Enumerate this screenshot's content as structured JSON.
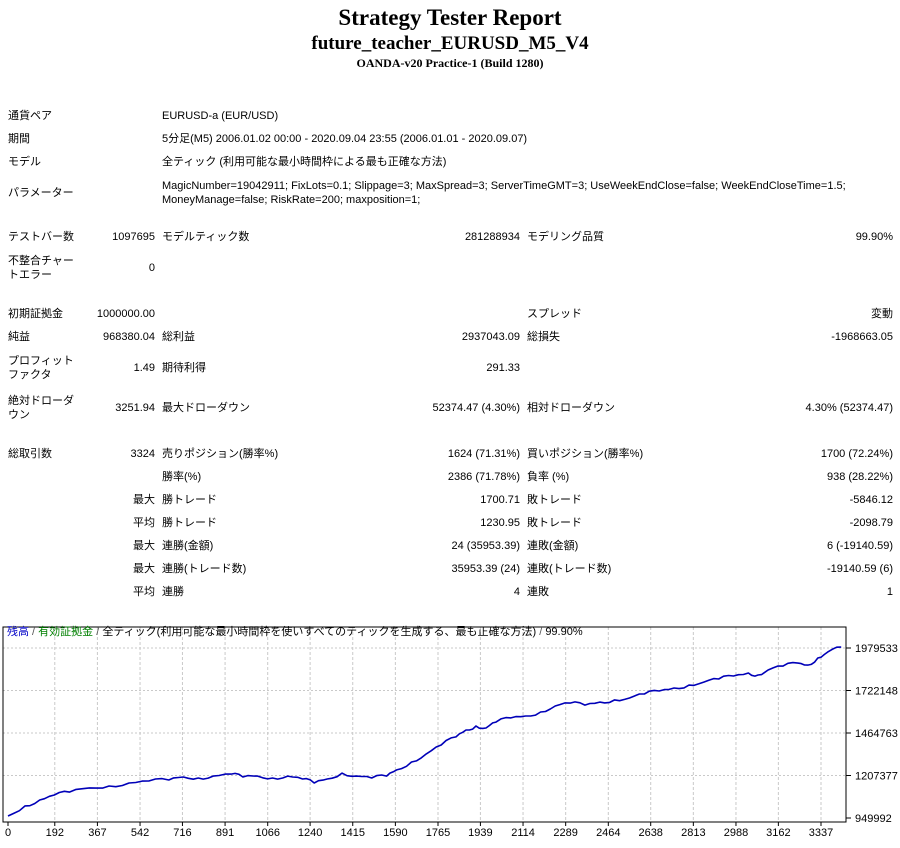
{
  "header": {
    "title": "Strategy Tester Report",
    "subtitle": "future_teacher_EURUSD_M5_V4",
    "server": "OANDA-v20 Practice-1 (Build 1280)"
  },
  "report_rows": [
    {
      "label": "通貨ペア",
      "span_lines": [
        "EURUSD-a (EUR/USD)"
      ]
    },
    {
      "label": "期間",
      "span_lines": [
        "5分足(M5) 2006.01.02 00:00 - 2020.09.04 23:55 (2006.01.01 - 2020.09.07)"
      ]
    },
    {
      "label": "モデル",
      "span_lines": [
        "全ティック (利用可能な最小時間枠による最も正確な方法)"
      ]
    },
    {
      "label": "パラメーター",
      "tall": true,
      "span_lines": [
        "MagicNumber=19042911; FixLots=0.1; Slippage=3; MaxSpread=3; ServerTimeGMT=3; UseWeekEndClose=false; WeekEndCloseTime=1.5;",
        "MoneyManage=false; RiskRate=200; maxposition=1;"
      ]
    },
    {
      "spacer": 1
    },
    {
      "label": "テストバー数",
      "v1": "1097695",
      "l2": "モデルティック数",
      "v2": "281288934",
      "l3": "モデリング品質",
      "v3": "99.90%"
    },
    {
      "label": "不整合チャートエラー",
      "tall": true,
      "v1": "0",
      "l2": "",
      "v2": "",
      "l3": "",
      "v3": ""
    },
    {
      "spacer": 2
    },
    {
      "label": "初期証拠金",
      "v1": "1000000.00",
      "l2": "",
      "v2": "",
      "l3": "スプレッド",
      "v3": "変動"
    },
    {
      "label": "純益",
      "v1": "968380.04",
      "l2": "総利益",
      "v2": "2937043.09",
      "l3": "総損失",
      "v3": "-1968663.05"
    },
    {
      "label": "プロフィットファクタ",
      "tall": true,
      "v1": "1.49",
      "l2": "期待利得",
      "v2": "291.33",
      "l3": "",
      "v3": ""
    },
    {
      "label": "絶対ドローダウン",
      "tall": true,
      "v1": "3251.94",
      "l2": "最大ドローダウン",
      "v2": "52374.47 (4.30%)",
      "l3": "相対ドローダウン",
      "v3": "4.30% (52374.47)"
    },
    {
      "spacer": 2
    },
    {
      "label": "総取引数",
      "v1": "3324",
      "l2": "売りポジション(勝率%)",
      "v2": "1624 (71.31%)",
      "l3": "買いポジション(勝率%)",
      "v3": "1700 (72.24%)"
    },
    {
      "label": "",
      "v1": "",
      "l2": "勝率(%)",
      "v2": "2386 (71.78%)",
      "l3": "負率 (%)",
      "v3": "938 (28.22%)"
    },
    {
      "label": "",
      "v1": "最大",
      "l2": "勝トレード",
      "v2": "1700.71",
      "l3": "敗トレード",
      "v3": "-5846.12"
    },
    {
      "label": "",
      "v1": "平均",
      "l2": "勝トレード",
      "v2": "1230.95",
      "l3": "敗トレード",
      "v3": "-2098.79"
    },
    {
      "label": "",
      "v1": "最大",
      "l2": "連勝(金額)",
      "v2": "24 (35953.39)",
      "l3": "連敗(金額)",
      "v3": "6 (-19140.59)"
    },
    {
      "label": "",
      "v1": "最大",
      "l2": "連勝(トレード数)",
      "v2": "35953.39 (24)",
      "l3": "連敗(トレード数)",
      "v3": "-19140.59 (6)"
    },
    {
      "label": "",
      "v1": "平均",
      "l2": "連勝",
      "v2": "4",
      "l3": "連敗",
      "v3": "1"
    }
  ],
  "chart_data": {
    "type": "line",
    "legend": {
      "balance_label": "残高",
      "equity_label": "有効証拠金",
      "model": "全ティック(利用可能な最小時間枠を使いすべてのティックを生成する、最も正確な方法)",
      "quality": "99.90%",
      "sep": " / "
    },
    "colors": {
      "balance": "#0000C8",
      "equity": "#008000",
      "line": "#0000B8",
      "grid": "#c9c9c9"
    },
    "x_axis": {
      "ticks": [
        0,
        192,
        367,
        542,
        716,
        891,
        1066,
        1240,
        1415,
        1590,
        1765,
        1939,
        2114,
        2289,
        2464,
        2638,
        2813,
        2988,
        3162,
        3337
      ]
    },
    "y_axis": {
      "ticks": [
        949992,
        1207377,
        1464763,
        1722148,
        1979533
      ]
    },
    "series": [
      {
        "name": "残高",
        "points": [
          [
            0,
            962000
          ],
          [
            70,
            1023000
          ],
          [
            130,
            1059000
          ],
          [
            190,
            1089000
          ],
          [
            252,
            1107000
          ],
          [
            334,
            1132000
          ],
          [
            415,
            1144000
          ],
          [
            497,
            1162000
          ],
          [
            578,
            1174000
          ],
          [
            660,
            1180000
          ],
          [
            720,
            1198000
          ],
          [
            781,
            1192000
          ],
          [
            842,
            1204000
          ],
          [
            916,
            1216000
          ],
          [
            964,
            1198000
          ],
          [
            1025,
            1204000
          ],
          [
            1086,
            1192000
          ],
          [
            1148,
            1204000
          ],
          [
            1209,
            1186000
          ],
          [
            1257,
            1162000
          ],
          [
            1310,
            1186000
          ],
          [
            1371,
            1222000
          ],
          [
            1432,
            1204000
          ],
          [
            1493,
            1192000
          ],
          [
            1554,
            1204000
          ],
          [
            1595,
            1241000
          ],
          [
            1656,
            1289000
          ],
          [
            1717,
            1338000
          ],
          [
            1778,
            1392000
          ],
          [
            1839,
            1441000
          ],
          [
            1880,
            1483000
          ],
          [
            1921,
            1507000
          ],
          [
            1962,
            1495000
          ],
          [
            2003,
            1531000
          ],
          [
            2064,
            1556000
          ],
          [
            2125,
            1568000
          ],
          [
            2186,
            1592000
          ],
          [
            2246,
            1628000
          ],
          [
            2307,
            1646000
          ],
          [
            2368,
            1634000
          ],
          [
            2429,
            1652000
          ],
          [
            2490,
            1665000
          ],
          [
            2551,
            1677000
          ],
          [
            2612,
            1701000
          ],
          [
            2673,
            1719000
          ],
          [
            2734,
            1737000
          ],
          [
            2795,
            1755000
          ],
          [
            2856,
            1773000
          ],
          [
            2917,
            1792000
          ],
          [
            2978,
            1810000
          ],
          [
            3039,
            1828000
          ],
          [
            3079,
            1816000
          ],
          [
            3120,
            1846000
          ],
          [
            3181,
            1870000
          ],
          [
            3242,
            1888000
          ],
          [
            3283,
            1876000
          ],
          [
            3324,
            1919000
          ],
          [
            3364,
            1955000
          ],
          [
            3420,
            1985000
          ]
        ]
      }
    ]
  }
}
